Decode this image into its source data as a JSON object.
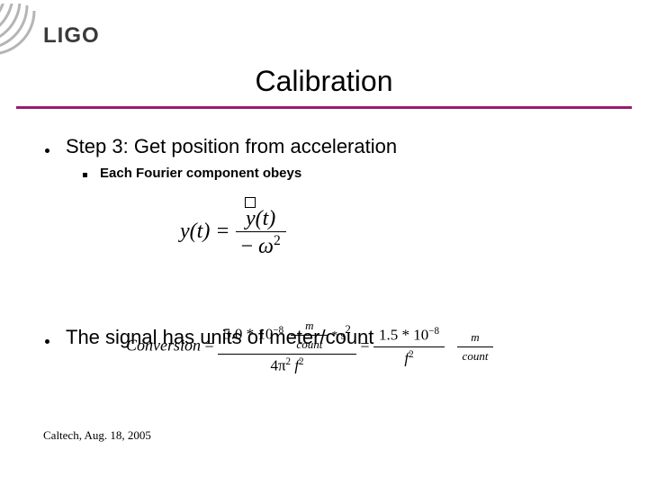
{
  "logo_text": "LIGO",
  "title": "Calibration",
  "bullet1": {
    "text": "Step 3: Get position from acceleration",
    "sub": "Each Fourier component obeys"
  },
  "formula1": {
    "lhs": "y(t) =",
    "num_var": "y",
    "num_arg": "(t)",
    "den_minus": "−",
    "den_omega": "ω",
    "den_exp": "2"
  },
  "bullet2": {
    "text": "The signal has units of meter/count"
  },
  "formula2": {
    "conv": "Conversion",
    "eq": " = ",
    "n1": "5.0 * 10",
    "e1": "−8",
    "u_num1_a": "m",
    "u_num1_b": "count",
    "u_star": " * s",
    "u_exp2": "2",
    "den_4pi": "4π",
    "den_pi_exp": "2",
    "den_f": " f",
    "den_f_exp": "2",
    "n2": "1.5 * 10",
    "e2": "−8",
    "over_f": "f",
    "over_f_exp": "2",
    "unit_m": "m",
    "unit_count": "count"
  },
  "footer": "Caltech, Aug. 18, 2005"
}
